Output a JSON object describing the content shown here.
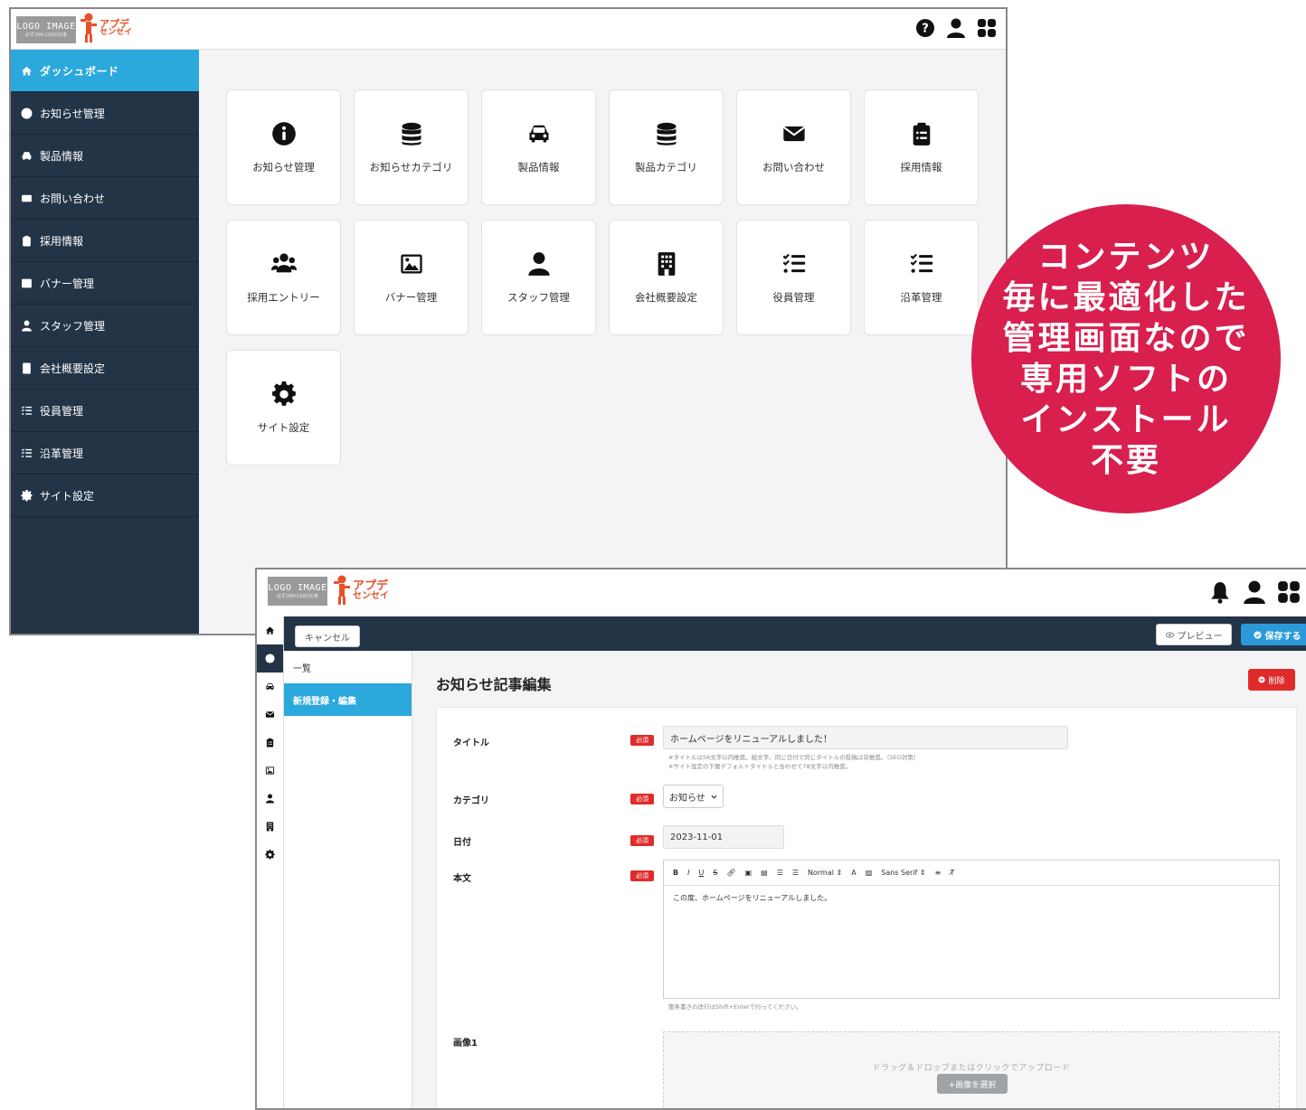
{
  "colors": {
    "sidebar_bg": "#243447",
    "accent_blue": "#2ba8dc",
    "callout_red": "#d81f4e",
    "required_red": "#e02b2b",
    "brand_orange": "#e8522a"
  },
  "brand": {
    "logo_text": "LOGO IMAGE",
    "logo_sub": "必ず200×110の比率",
    "name_line1": "アプデ",
    "name_line2": "センセイ"
  },
  "dashboard": {
    "header_icons": [
      "help-icon",
      "user-icon",
      "apps-grid-icon"
    ],
    "sidebar": [
      {
        "label": "ダッシュボード",
        "icon": "home-icon",
        "active": true
      },
      {
        "label": "お知らせ管理",
        "icon": "info-icon"
      },
      {
        "label": "製品情報",
        "icon": "car-icon"
      },
      {
        "label": "お問い合わせ",
        "icon": "envelope-icon"
      },
      {
        "label": "採用情報",
        "icon": "clipboard-icon"
      },
      {
        "label": "バナー管理",
        "icon": "image-icon"
      },
      {
        "label": "スタッフ管理",
        "icon": "user-icon"
      },
      {
        "label": "会社概要設定",
        "icon": "building-icon"
      },
      {
        "label": "役員管理",
        "icon": "checklist-icon"
      },
      {
        "label": "沿革管理",
        "icon": "checklist-icon"
      },
      {
        "label": "サイト設定",
        "icon": "gear-icon"
      }
    ],
    "tiles": [
      {
        "label": "お知らせ管理",
        "icon": "info-icon"
      },
      {
        "label": "お知らせカテゴリ",
        "icon": "database-icon"
      },
      {
        "label": "製品情報",
        "icon": "car-icon"
      },
      {
        "label": "製品カテゴリ",
        "icon": "database-icon"
      },
      {
        "label": "お問い合わせ",
        "icon": "envelope-icon"
      },
      {
        "label": "採用情報",
        "icon": "clipboard-icon"
      },
      {
        "label": "採用エントリー",
        "icon": "users-icon"
      },
      {
        "label": "バナー管理",
        "icon": "image-icon"
      },
      {
        "label": "スタッフ管理",
        "icon": "user-icon"
      },
      {
        "label": "会社概要設定",
        "icon": "building-icon"
      },
      {
        "label": "役員管理",
        "icon": "checklist-icon"
      },
      {
        "label": "沿革管理",
        "icon": "checklist-icon"
      },
      {
        "label": "サイト設定",
        "icon": "gear-icon"
      }
    ]
  },
  "callout": {
    "lines": [
      "コンテンツ",
      "毎に最適化した",
      "管理画面なので",
      "専用ソフトの",
      "インストール",
      "不要"
    ]
  },
  "editor_window": {
    "header_icons": [
      "bell-icon",
      "user-icon",
      "apps-grid-icon"
    ],
    "toolbar": {
      "cancel_label": "キャンセル",
      "preview_label": "プレビュー",
      "save_label": "保存する"
    },
    "icon_rail": [
      "home-icon",
      "info-icon",
      "car-icon",
      "envelope-icon",
      "clipboard-icon",
      "image-icon",
      "user-icon",
      "building-icon",
      "gear-icon"
    ],
    "subnav": [
      {
        "label": "一覧"
      },
      {
        "label": "新規登録・編集",
        "active": true
      }
    ],
    "page_title": "お知らせ記事編集",
    "delete_label": "削除",
    "required_badge": "必須",
    "fields": {
      "title_label": "タイトル",
      "title_value": "ホームページをリニューアルしました！",
      "title_note1": "※タイトルは56文字以内推奨。絵文字、同じ日付で同じタイトルの投稿は非推奨。（SEO対策）",
      "title_note2": "※サイト設定の下層デフォルトタイトルと合わせて78文字以内推奨。",
      "category_label": "カテゴリ",
      "category_value": "お知らせ",
      "date_label": "日付",
      "date_value": "2023-11-01",
      "body_label": "本文",
      "body_toolbar": {
        "normal": "Normal",
        "font": "Sans Serif"
      },
      "body_value": "この度、ホームページをリニューアルしました。",
      "body_note": "箇条書きの改行はShift+Enterで行ってください。",
      "image_label": "画像1",
      "dropzone_text": "ドラッグ＆ドロップまたはクリックでアップロード",
      "select_image_label": "+画像を選択"
    }
  }
}
